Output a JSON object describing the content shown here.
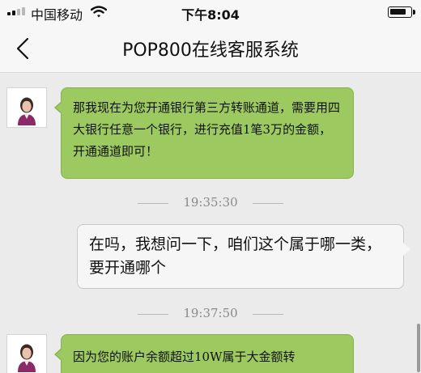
{
  "status_bar": {
    "carrier": "中国移动",
    "time": "下午8:04"
  },
  "nav": {
    "title": "POP800在线客服系统"
  },
  "messages": [
    {
      "side": "left",
      "text": "那我现在为您开通银行第三方转账通道，需要用四大银行任意一个银行，进行充值1笔3万的金额，开通通道即可！"
    },
    {
      "timestamp": "19:35:30"
    },
    {
      "side": "right",
      "text": "在吗，我想问一下，咱们这个属于哪一类，要开通哪个"
    },
    {
      "timestamp": "19:37:50"
    },
    {
      "side": "left",
      "text": "因为您的账户余额超过10W属于大金额转"
    }
  ],
  "colors": {
    "agent_bubble": "#9cc960",
    "user_bubble": "#f6f6f6",
    "background": "#ebebeb"
  },
  "icons": [
    "back-chevron-icon",
    "signal-icon",
    "wifi-icon",
    "battery-icon",
    "avatar-icon"
  ]
}
